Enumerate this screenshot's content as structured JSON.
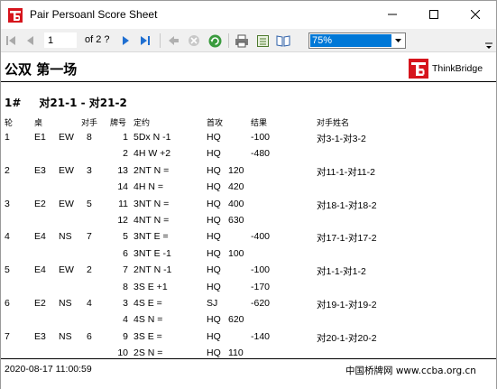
{
  "window": {
    "title": "Pair Persoanl Score Sheet"
  },
  "toolbar": {
    "page_value": "1",
    "page_of": "of  2 ?",
    "zoom_value": "75%",
    "icons": [
      "first-page-icon",
      "prev-page-icon",
      "next-page-icon",
      "last-page-icon",
      "back-icon",
      "stop-icon",
      "refresh-icon",
      "print-icon",
      "page-setup-icon",
      "layout-icon",
      "chevron-down-icon"
    ]
  },
  "report": {
    "title": "公双 第一场",
    "brand": "ThinkBridge",
    "pair_no": "1#",
    "pair_names": "对21-1 -  对21-2",
    "headers": {
      "round": "轮",
      "table": "桌",
      "direction": "",
      "opponent": "对手",
      "board": "牌号",
      "contract": "定约",
      "lead": "首攻",
      "result": "结果",
      "opponent_names": "对手姓名"
    },
    "rows": [
      {
        "round": "1",
        "table": "E1",
        "dir": "EW",
        "opp": "8",
        "board": "1",
        "contract": "5Dx  N -1",
        "lead": "HQ",
        "s1": "",
        "s2": "-100",
        "names": "对3-1-对3-2"
      },
      {
        "round": "",
        "table": "",
        "dir": "",
        "opp": "",
        "board": "2",
        "contract": "4H  W +2",
        "lead": "HQ",
        "s1": "",
        "s2": "-480",
        "names": ""
      },
      {
        "round": "2",
        "table": "E3",
        "dir": "EW",
        "opp": "3",
        "board": "13",
        "contract": "2NT  N =",
        "lead": "HQ",
        "s1": "120",
        "s2": "",
        "names": "对11-1-对11-2"
      },
      {
        "round": "",
        "table": "",
        "dir": "",
        "opp": "",
        "board": "14",
        "contract": "4H  N =",
        "lead": "HQ",
        "s1": "420",
        "s2": "",
        "names": ""
      },
      {
        "round": "3",
        "table": "E2",
        "dir": "EW",
        "opp": "5",
        "board": "11",
        "contract": "3NT  N =",
        "lead": "HQ",
        "s1": "400",
        "s2": "",
        "names": "对18-1-对18-2"
      },
      {
        "round": "",
        "table": "",
        "dir": "",
        "opp": "",
        "board": "12",
        "contract": "4NT  N =",
        "lead": "HQ",
        "s1": "630",
        "s2": "",
        "names": ""
      },
      {
        "round": "4",
        "table": "E4",
        "dir": "NS",
        "opp": "7",
        "board": "5",
        "contract": "3NT  E =",
        "lead": "HQ",
        "s1": "",
        "s2": "-400",
        "names": "对17-1-对17-2"
      },
      {
        "round": "",
        "table": "",
        "dir": "",
        "opp": "",
        "board": "6",
        "contract": "3NT  E -1",
        "lead": "HQ",
        "s1": "100",
        "s2": "",
        "names": ""
      },
      {
        "round": "5",
        "table": "E4",
        "dir": "EW",
        "opp": "2",
        "board": "7",
        "contract": "2NT  N -1",
        "lead": "HQ",
        "s1": "",
        "s2": "-100",
        "names": "对1-1-对1-2"
      },
      {
        "round": "",
        "table": "",
        "dir": "",
        "opp": "",
        "board": "8",
        "contract": "3S  E +1",
        "lead": "HQ",
        "s1": "",
        "s2": "-170",
        "names": ""
      },
      {
        "round": "6",
        "table": "E2",
        "dir": "NS",
        "opp": "4",
        "board": "3",
        "contract": "4S  E =",
        "lead": "SJ",
        "s1": "",
        "s2": "-620",
        "names": "对19-1-对19-2"
      },
      {
        "round": "",
        "table": "",
        "dir": "",
        "opp": "",
        "board": "4",
        "contract": "4S  N =",
        "lead": "HQ",
        "s1": "620",
        "s2": "",
        "names": ""
      },
      {
        "round": "7",
        "table": "E3",
        "dir": "NS",
        "opp": "6",
        "board": "9",
        "contract": "3S  E =",
        "lead": "HQ",
        "s1": "",
        "s2": "-140",
        "names": "对20-1-对20-2"
      },
      {
        "round": "",
        "table": "",
        "dir": "",
        "opp": "",
        "board": "10",
        "contract": "2S  N =",
        "lead": "HQ",
        "s1": "110",
        "s2": "",
        "names": ""
      }
    ],
    "footer_date": "2020-08-17  11:00:59",
    "footer_site": "中国桥牌网 www.ccba.org.cn"
  },
  "colors": {
    "brand_red": "#d6141c",
    "selection_blue": "#0078d7",
    "toolbar_bg": "#f0f0f0",
    "nav_blue": "#1f6fd1"
  }
}
